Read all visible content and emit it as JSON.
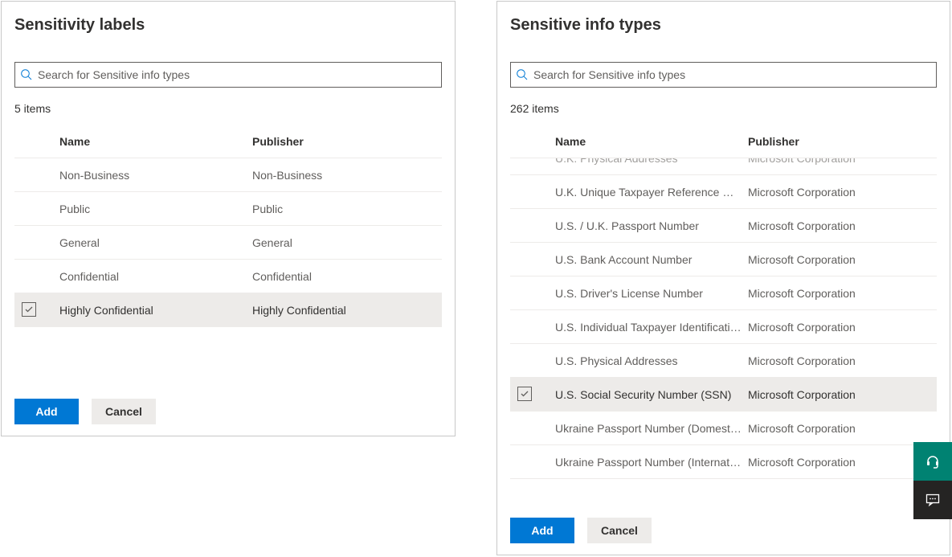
{
  "left": {
    "title": "Sensitivity labels",
    "search_placeholder": "Search for Sensitive info types",
    "count": "5 items",
    "columns": {
      "name": "Name",
      "publisher": "Publisher"
    },
    "rows": [
      {
        "name": "Non-Business",
        "publisher": "Non-Business",
        "selected": false
      },
      {
        "name": "Public",
        "publisher": "Public",
        "selected": false
      },
      {
        "name": "General",
        "publisher": "General",
        "selected": false
      },
      {
        "name": "Confidential",
        "publisher": "Confidential",
        "selected": false
      },
      {
        "name": "Highly Confidential",
        "publisher": "Highly Confidential",
        "selected": true
      }
    ],
    "add": "Add",
    "cancel": "Cancel"
  },
  "right": {
    "title": "Sensitive info types",
    "search_placeholder": "Search for Sensitive info types",
    "count": "262 items",
    "columns": {
      "name": "Name",
      "publisher": "Publisher"
    },
    "rows": [
      {
        "name": "U.K. Physical Addresses",
        "publisher": "Microsoft Corporation",
        "selected": false,
        "partial": true
      },
      {
        "name": "U.K. Unique Taxpayer Reference Number",
        "publisher": "Microsoft Corporation",
        "selected": false
      },
      {
        "name": "U.S. / U.K. Passport Number",
        "publisher": "Microsoft Corporation",
        "selected": false
      },
      {
        "name": "U.S. Bank Account Number",
        "publisher": "Microsoft Corporation",
        "selected": false
      },
      {
        "name": "U.S. Driver's License Number",
        "publisher": "Microsoft Corporation",
        "selected": false
      },
      {
        "name": "U.S. Individual Taxpayer Identification Number",
        "publisher": "Microsoft Corporation",
        "selected": false
      },
      {
        "name": "U.S. Physical Addresses",
        "publisher": "Microsoft Corporation",
        "selected": false
      },
      {
        "name": "U.S. Social Security Number (SSN)",
        "publisher": "Microsoft Corporation",
        "selected": true
      },
      {
        "name": "Ukraine Passport Number (Domestic)",
        "publisher": "Microsoft Corporation",
        "selected": false
      },
      {
        "name": "Ukraine Passport Number (International)",
        "publisher": "Microsoft Corporation",
        "selected": false
      }
    ],
    "add": "Add",
    "cancel": "Cancel"
  }
}
